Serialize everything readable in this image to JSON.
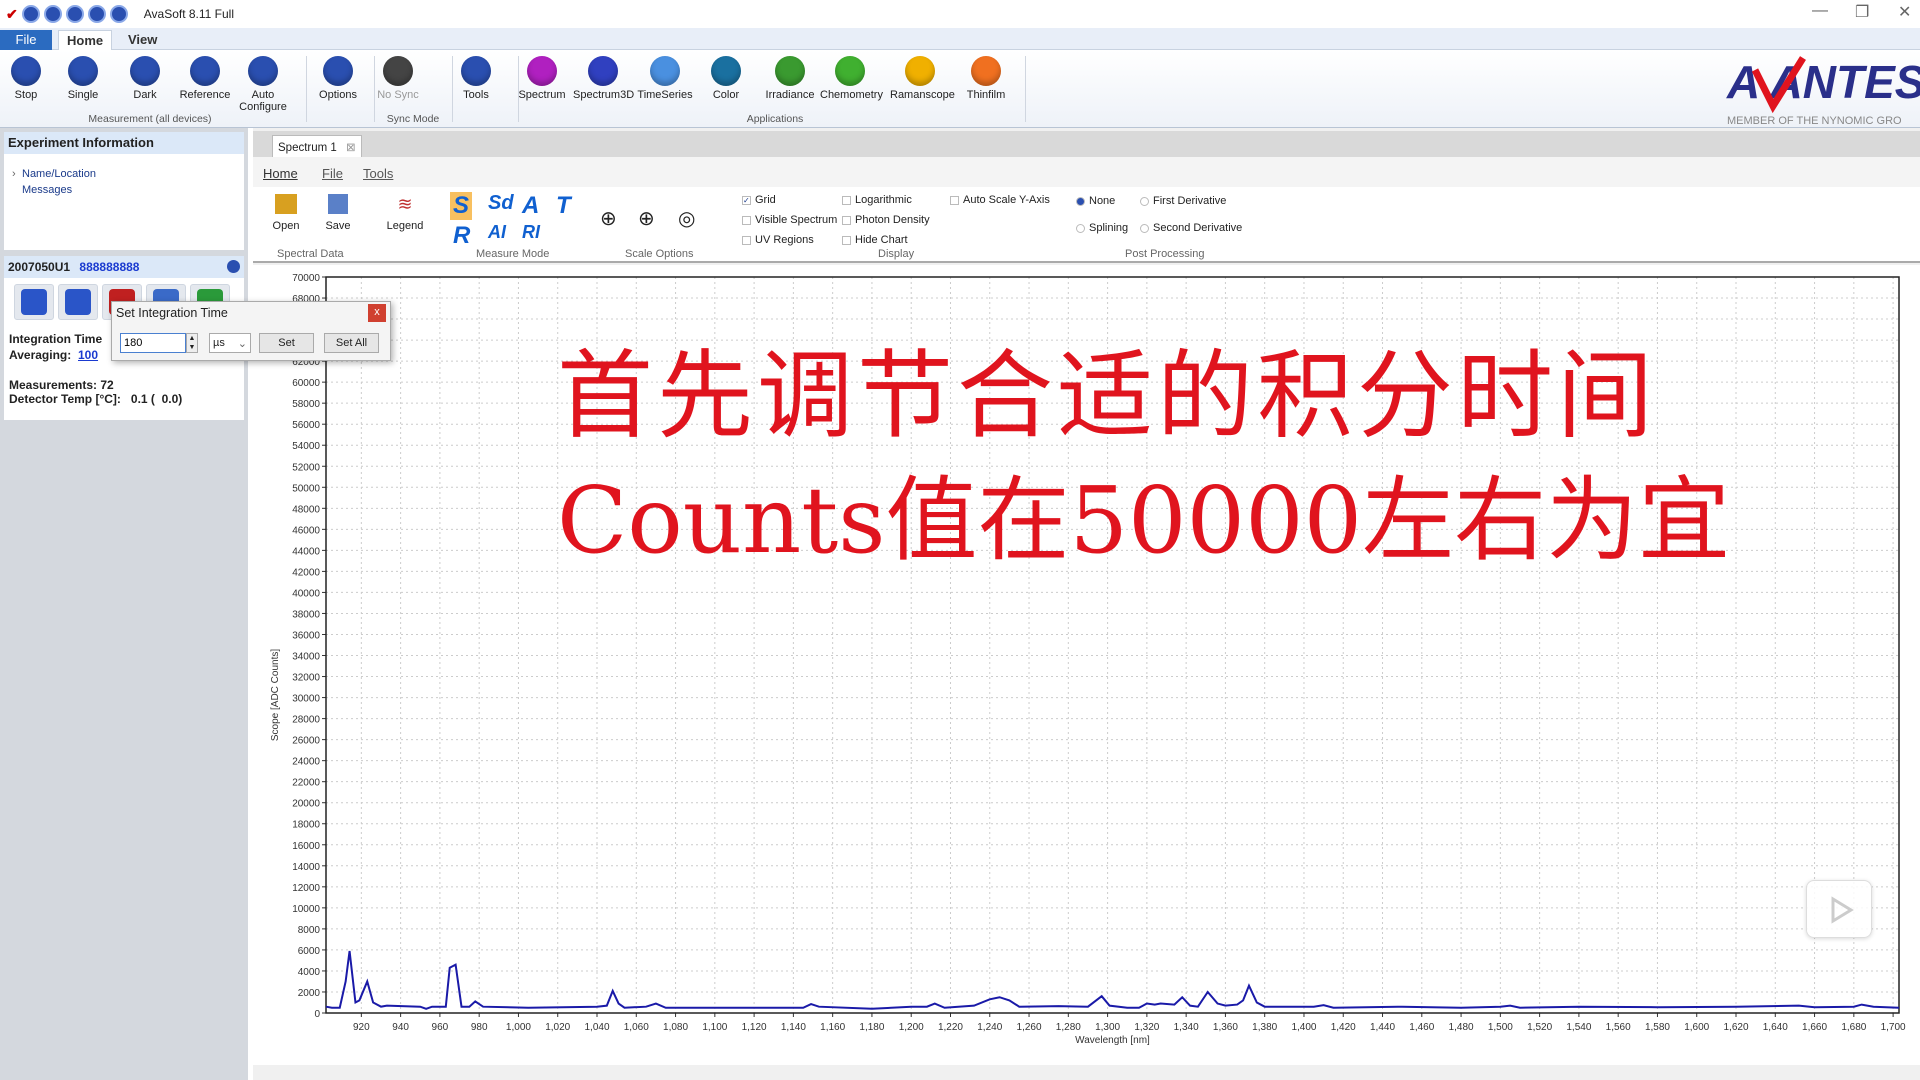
{
  "window": {
    "title": "AvaSoft 8.11 Full",
    "minimize": "—",
    "restore": "❐",
    "close": "✕"
  },
  "ribbon_tabs": [
    "File",
    "Home",
    "View"
  ],
  "ribbon": {
    "buttons": [
      {
        "label": "Stop",
        "icon": "stop-icon",
        "color": "#2a4fb0"
      },
      {
        "label": "Single",
        "icon": "single-icon",
        "color": "#2a4fb0"
      },
      {
        "label": "Dark",
        "icon": "bulb-off-icon",
        "color": "#2a4fb0"
      },
      {
        "label": "Reference",
        "icon": "bulb-icon",
        "color": "#2a4fb0"
      },
      {
        "label": "Auto Configure",
        "icon": "auto-configure-icon",
        "color": "#2a4fb0"
      },
      {
        "label": "Options",
        "icon": "wrench-icon",
        "color": "#2a4fb0"
      },
      {
        "label": "No Sync",
        "icon": "link-icon",
        "color": "#444444"
      },
      {
        "label": "Tools",
        "icon": "toolbox-icon",
        "color": "#2a4fb0"
      },
      {
        "label": "Spectrum",
        "icon": "spectrum-icon",
        "color": "#b020c0"
      },
      {
        "label": "Spectrum3D",
        "icon": "spectrum3d-icon",
        "color": "#3040c0"
      },
      {
        "label": "TimeSeries",
        "icon": "timeseries-icon",
        "color": "#4a90e0"
      },
      {
        "label": "Color",
        "icon": "color-icon",
        "color": "#1a70a0"
      },
      {
        "label": "Irradiance",
        "icon": "irradiance-icon",
        "color": "#3a9a30"
      },
      {
        "label": "Chemometry",
        "icon": "chemometry-icon",
        "color": "#40b030"
      },
      {
        "label": "Ramanscope",
        "icon": "ramanscope-icon",
        "color": "#f0b000"
      },
      {
        "label": "Thinfilm",
        "icon": "thinfilm-icon",
        "color": "#f07020"
      }
    ],
    "groups": [
      "Measurement (all devices)",
      "Sync Mode",
      "Applications"
    ],
    "logo_text": "AVANTES",
    "logo_sub": "MEMBER OF THE NYNOMIC GRO"
  },
  "left": {
    "experiment_header": "Experiment Information",
    "tree": [
      "Name/Location",
      "Messages"
    ],
    "device_id": "2007050U1",
    "device_tag": "888888888",
    "integration_label": "Integration Time",
    "averaging_label": "Averaging:",
    "averaging_value": "100",
    "measurements": "Measurements: 72",
    "detector_temp": "Detector Temp [°C]:   0.1 (  0.0)"
  },
  "dialog": {
    "title": "Set Integration Time",
    "value": "180",
    "unit": "µs",
    "set": "Set",
    "set_all": "Set All",
    "close": "x"
  },
  "doc_tab": "Spectrum 1",
  "inner_tabs": [
    "Home",
    "File",
    "Tools"
  ],
  "inner_ribbon": {
    "open": "Open",
    "save": "Save",
    "legend": "Legend",
    "groups": [
      "Spectral Data",
      "Measure Mode",
      "Scale Options",
      "Display",
      "Post Processing"
    ],
    "measure_modes": [
      "S",
      "Sd",
      "A",
      "T",
      "R",
      "AI",
      "RI"
    ],
    "display": [
      {
        "label": "Grid",
        "checked": true
      },
      {
        "label": "Visible Spectrum",
        "checked": false
      },
      {
        "label": "UV Regions",
        "checked": false
      },
      {
        "label": "Logarithmic",
        "checked": false
      },
      {
        "label": "Photon Density",
        "checked": false
      },
      {
        "label": "Hide Chart",
        "checked": false
      },
      {
        "label": "Auto Scale Y-Axis",
        "checked": false
      }
    ],
    "post": [
      {
        "label": "None",
        "selected": true
      },
      {
        "label": "First Derivative",
        "selected": false
      },
      {
        "label": "Splining",
        "selected": false
      },
      {
        "label": "Second Derivative",
        "selected": false
      }
    ]
  },
  "overlay": {
    "line1": "首先调节合适的积分时间",
    "line2": "Counts值在50000左右为宜"
  },
  "chart_data": {
    "type": "line",
    "xlabel": "Wavelength [nm]",
    "ylabel": "Scope [ADC Counts]",
    "xlim": [
      902,
      1703
    ],
    "ylim": [
      0,
      70000
    ],
    "xticks": [
      920,
      940,
      960,
      980,
      1000,
      1020,
      1040,
      1060,
      1080,
      1100,
      1120,
      1140,
      1160,
      1180,
      1200,
      1220,
      1240,
      1260,
      1280,
      1300,
      1320,
      1340,
      1360,
      1380,
      1400,
      1420,
      1440,
      1460,
      1480,
      1500,
      1520,
      1540,
      1560,
      1580,
      1600,
      1620,
      1640,
      1660,
      1680,
      1700
    ],
    "ytick_step": 2000,
    "grid": true,
    "line_color": "#1a1aa8",
    "series": [
      {
        "points": [
          [
            902,
            600
          ],
          [
            905,
            500
          ],
          [
            909,
            500
          ],
          [
            912,
            3000
          ],
          [
            914,
            5900
          ],
          [
            917,
            1000
          ],
          [
            919,
            1200
          ],
          [
            923,
            3000
          ],
          [
            926,
            1000
          ],
          [
            930,
            600
          ],
          [
            933,
            700
          ],
          [
            950,
            600
          ],
          [
            953,
            400
          ],
          [
            956,
            600
          ],
          [
            963,
            600
          ],
          [
            965,
            4300
          ],
          [
            968,
            4600
          ],
          [
            971,
            600
          ],
          [
            975,
            600
          ],
          [
            978,
            1100
          ],
          [
            982,
            600
          ],
          [
            1005,
            500
          ],
          [
            1040,
            600
          ],
          [
            1045,
            700
          ],
          [
            1048,
            2100
          ],
          [
            1051,
            900
          ],
          [
            1054,
            500
          ],
          [
            1065,
            600
          ],
          [
            1070,
            900
          ],
          [
            1075,
            500
          ],
          [
            1145,
            500
          ],
          [
            1149,
            850
          ],
          [
            1153,
            600
          ],
          [
            1180,
            400
          ],
          [
            1200,
            600
          ],
          [
            1208,
            600
          ],
          [
            1212,
            900
          ],
          [
            1217,
            500
          ],
          [
            1232,
            700
          ],
          [
            1240,
            1300
          ],
          [
            1245,
            1500
          ],
          [
            1250,
            1200
          ],
          [
            1255,
            600
          ],
          [
            1275,
            650
          ],
          [
            1290,
            600
          ],
          [
            1297,
            1600
          ],
          [
            1301,
            700
          ],
          [
            1310,
            500
          ],
          [
            1316,
            500
          ],
          [
            1320,
            900
          ],
          [
            1324,
            800
          ],
          [
            1327,
            900
          ],
          [
            1334,
            800
          ],
          [
            1338,
            1500
          ],
          [
            1342,
            700
          ],
          [
            1346,
            600
          ],
          [
            1351,
            2000
          ],
          [
            1356,
            900
          ],
          [
            1360,
            700
          ],
          [
            1366,
            800
          ],
          [
            1369,
            1200
          ],
          [
            1372,
            2600
          ],
          [
            1376,
            1000
          ],
          [
            1380,
            600
          ],
          [
            1400,
            600
          ],
          [
            1405,
            600
          ],
          [
            1410,
            750
          ],
          [
            1415,
            500
          ],
          [
            1450,
            600
          ],
          [
            1480,
            500
          ],
          [
            1500,
            600
          ],
          [
            1505,
            700
          ],
          [
            1510,
            500
          ],
          [
            1540,
            600
          ],
          [
            1580,
            550
          ],
          [
            1620,
            600
          ],
          [
            1652,
            700
          ],
          [
            1660,
            550
          ],
          [
            1680,
            600
          ],
          [
            1684,
            800
          ],
          [
            1690,
            600
          ],
          [
            1703,
            500
          ]
        ]
      }
    ]
  }
}
